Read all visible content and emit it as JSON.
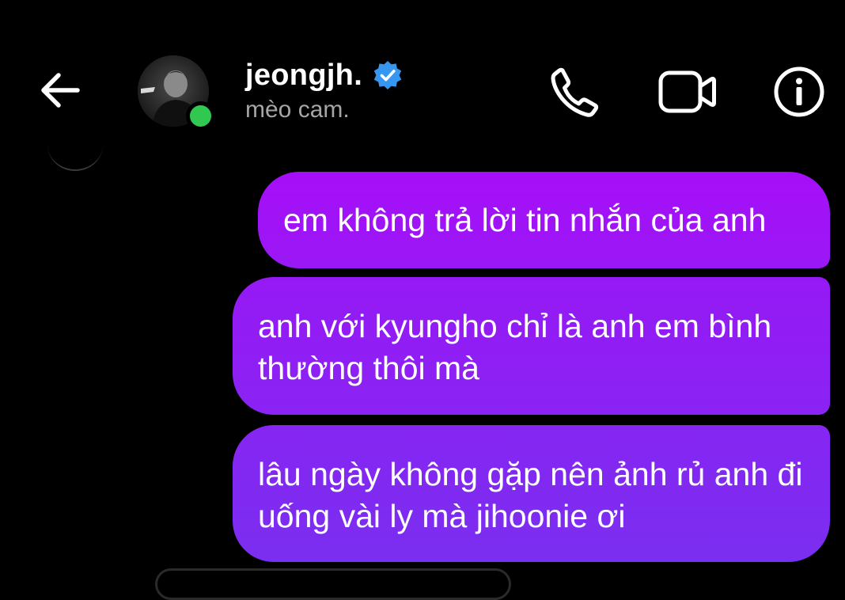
{
  "header": {
    "contact_name": "jeongjh.",
    "contact_subtitle": "mèo cam.",
    "verified": true,
    "online_status_color": "#31c852",
    "verified_color": "#3797f0",
    "icons": {
      "back": "back-arrow-icon",
      "call": "phone-icon",
      "video": "video-camera-icon",
      "info": "info-icon"
    }
  },
  "thread": {
    "bubble_colors": [
      "#a60ef8",
      "#8626f2"
    ],
    "messages": [
      {
        "sender": "me",
        "text": "em không trả lời tin nhắn của anh"
      },
      {
        "sender": "me",
        "text": "anh với kyungho chỉ là anh em bình thường thôi mà"
      },
      {
        "sender": "me",
        "text": "lâu ngày không gặp nên ảnh rủ anh đi uống vài ly mà jihoonie ơi"
      }
    ]
  }
}
